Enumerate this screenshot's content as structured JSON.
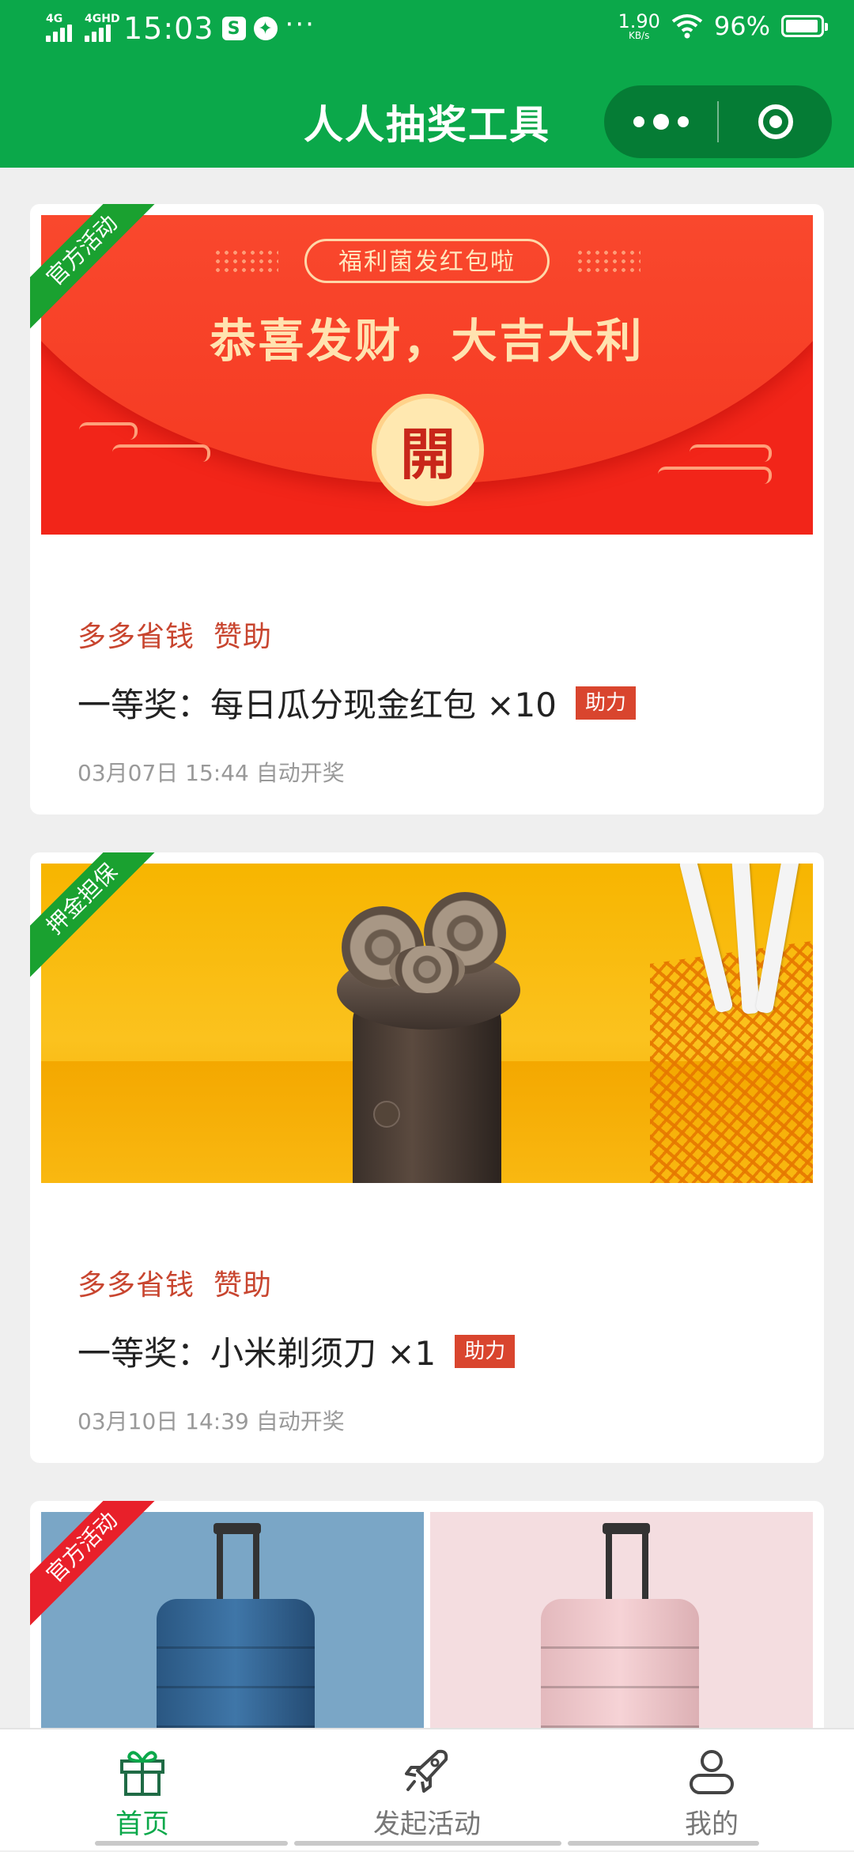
{
  "status_bar": {
    "network_1": "4G",
    "network_2": "4GHD",
    "time": "15:03",
    "more_indicator": "···",
    "speed_value": "1.90",
    "speed_unit": "KB/s",
    "battery": "96%",
    "battery_level": 0.96
  },
  "app_bar": {
    "title": "人人抽奖工具"
  },
  "cards": [
    {
      "ribbon": "官方活动",
      "ribbon_color": "#1aa130",
      "banner": {
        "pill_text": "福利菌发红包啦",
        "headline": "恭喜发财，大吉大利",
        "coin_char": "開"
      },
      "sponsor": "多多省钱",
      "sponsor_tag": "赞助",
      "prize": "一等奖：每日瓜分现金红包 ×10",
      "badge": "助力",
      "draw_time": "03月07日 15:44 自动开奖"
    },
    {
      "ribbon": "押金担保",
      "ribbon_color": "#1aa130",
      "sponsor": "多多省钱",
      "sponsor_tag": "赞助",
      "prize": "一等奖：小米剃须刀 ×1",
      "badge": "助力",
      "draw_time": "03月10日 14:39 自动开奖"
    },
    {
      "ribbon": "官方活动",
      "ribbon_color": "#e8202a"
    }
  ],
  "tabbar": {
    "tabs": [
      {
        "label": "首页",
        "icon": "gift-icon",
        "active": true
      },
      {
        "label": "发起活动",
        "icon": "rocket-icon",
        "active": false
      },
      {
        "label": "我的",
        "icon": "user-icon",
        "active": false
      }
    ],
    "active_color": "#0ba84a"
  },
  "colors": {
    "brand_green": "#0ba84a",
    "sponsor_text": "#c8452f",
    "badge_bg": "#d9452e"
  }
}
